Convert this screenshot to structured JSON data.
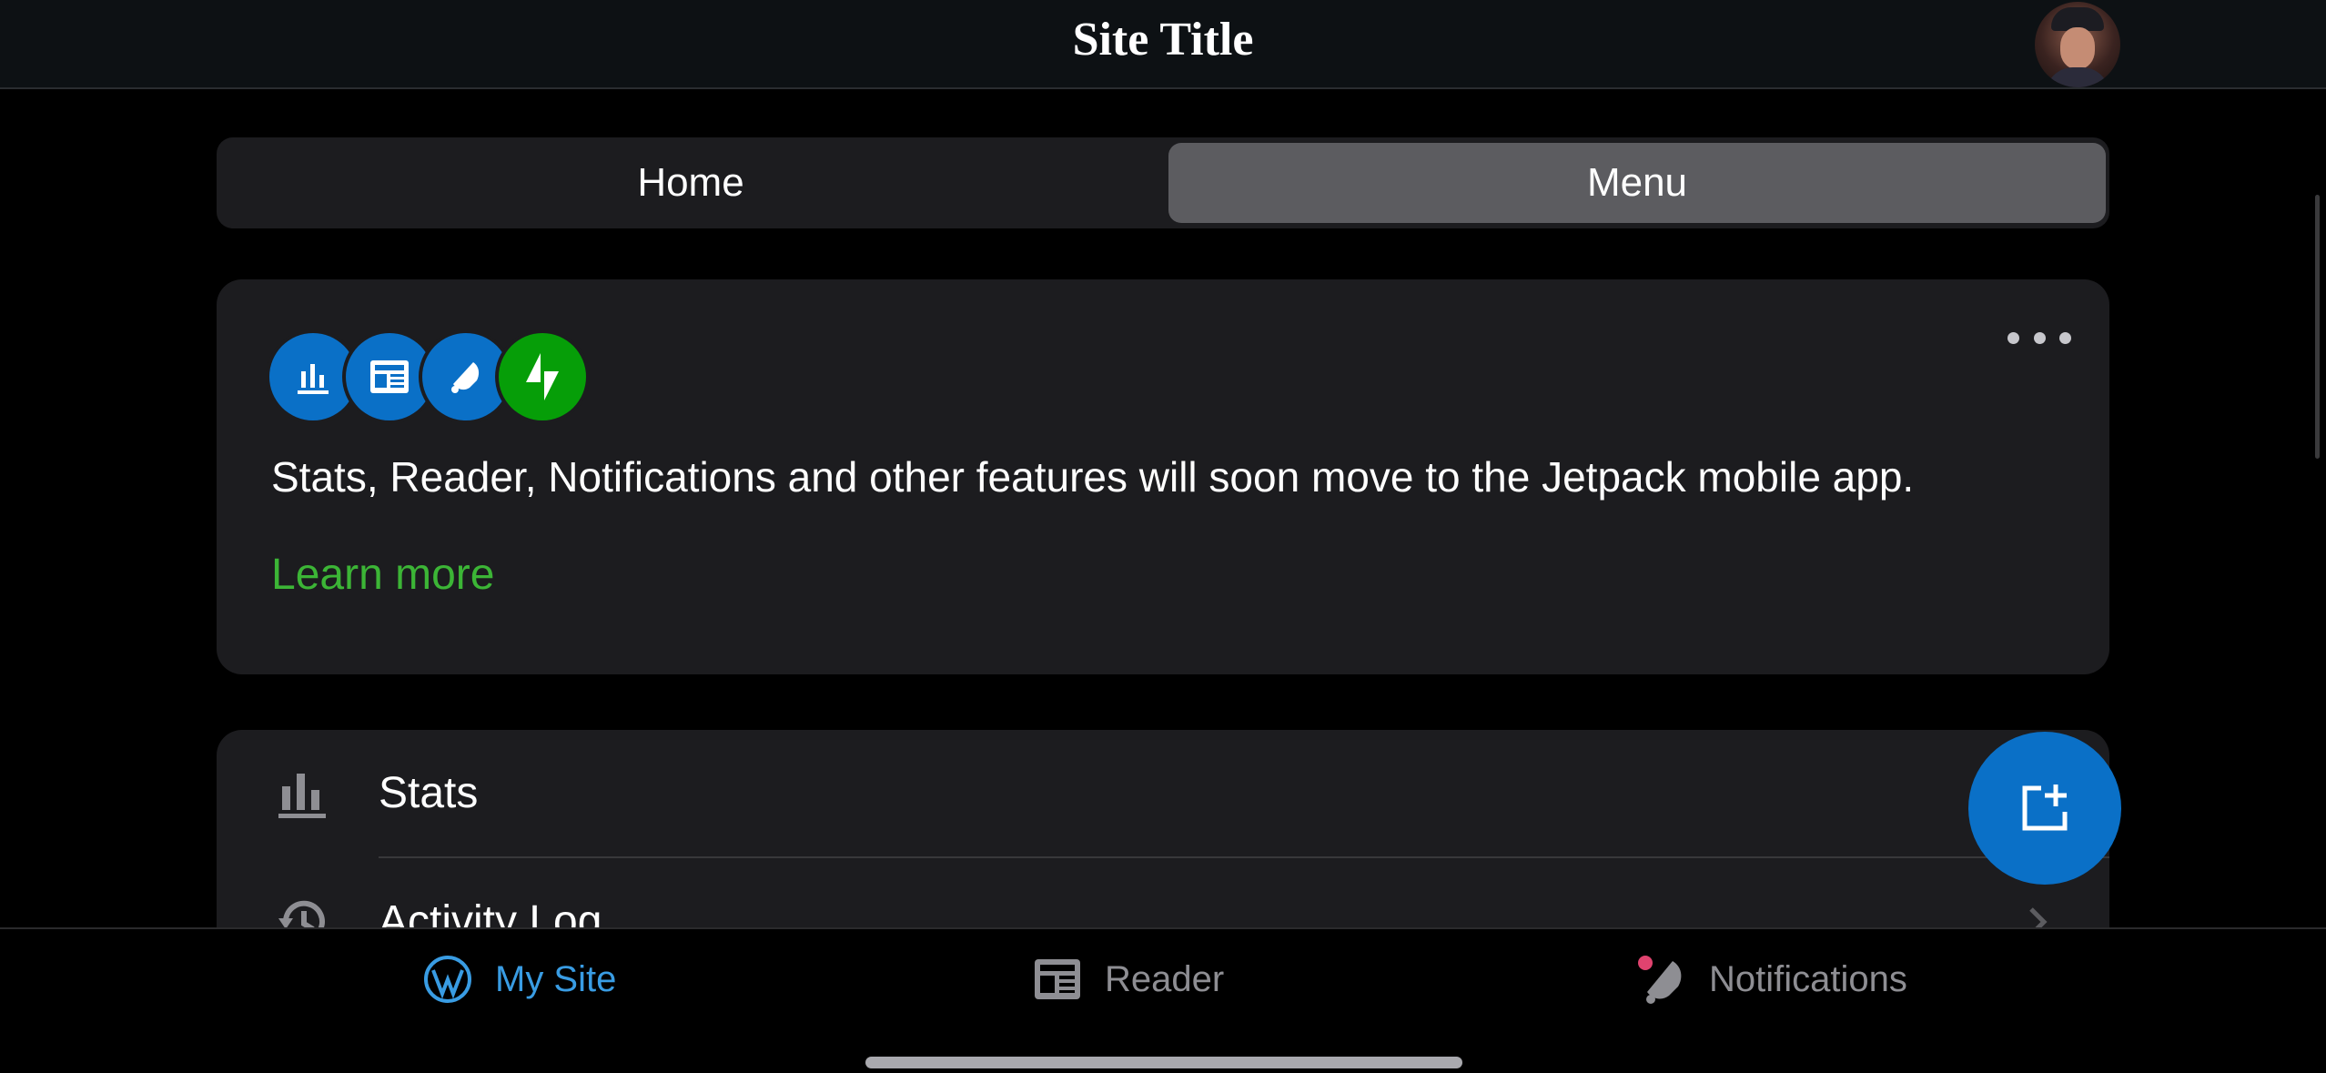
{
  "header": {
    "title": "Site Title"
  },
  "segmented_control": {
    "items": [
      {
        "label": "Home",
        "selected": false
      },
      {
        "label": "Menu",
        "selected": true
      }
    ]
  },
  "jetpack_card": {
    "feature_icons": [
      "stats-icon",
      "reader-icon",
      "notifications-icon",
      "jetpack-icon"
    ],
    "message": "Stats, Reader, Notifications and other features will soon move to the Jetpack mobile app.",
    "link_label": "Learn more",
    "accent_color": "#3cb536"
  },
  "menu": {
    "items": [
      {
        "label": "Stats",
        "icon": "stats-icon"
      },
      {
        "label": "Activity Log",
        "icon": "activity-log-icon"
      }
    ]
  },
  "fab": {
    "icon": "create-post-icon",
    "color": "#0a70c7"
  },
  "tab_bar": {
    "items": [
      {
        "label": "My Site",
        "icon": "wordpress-icon",
        "active": true
      },
      {
        "label": "Reader",
        "icon": "reader-icon",
        "active": false
      },
      {
        "label": "Notifications",
        "icon": "notifications-icon",
        "active": false,
        "badge": true
      }
    ],
    "active_color": "#399ce3",
    "inactive_color": "#8e8e93"
  }
}
